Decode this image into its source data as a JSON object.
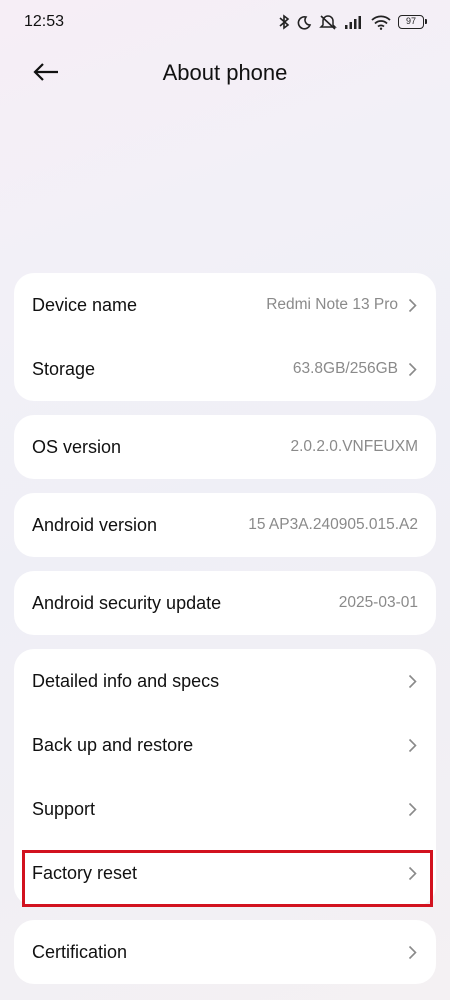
{
  "status_bar": {
    "time": "12:53",
    "battery": "97",
    "icons": [
      "bluetooth-icon",
      "moon-icon",
      "mute-icon",
      "signal-icon",
      "wifi-icon",
      "battery-icon"
    ]
  },
  "header": {
    "title": "About phone",
    "back_icon": "arrow-left-icon"
  },
  "groups": [
    {
      "rows": [
        {
          "label": "Device name",
          "value": "Redmi Note 13 Pro",
          "chevron": true
        },
        {
          "label": "Storage",
          "value": "63.8GB/256GB",
          "chevron": true
        }
      ]
    },
    {
      "rows": [
        {
          "label": "OS version",
          "value": "2.0.2.0.VNFEUXM",
          "chevron": false
        }
      ]
    },
    {
      "rows": [
        {
          "label": "Android version",
          "value": "15 AP3A.240905.015.A2",
          "chevron": false
        }
      ]
    },
    {
      "rows": [
        {
          "label": "Android security update",
          "value": "2025-03-01",
          "chevron": false
        }
      ]
    },
    {
      "rows": [
        {
          "label": "Detailed info and specs",
          "value": "",
          "chevron": true
        },
        {
          "label": "Back up and restore",
          "value": "",
          "chevron": true
        },
        {
          "label": "Support",
          "value": "",
          "chevron": true
        },
        {
          "label": "Factory reset",
          "value": "",
          "chevron": true,
          "highlighted": true
        }
      ]
    },
    {
      "rows": [
        {
          "label": "Certification",
          "value": "",
          "chevron": true
        }
      ]
    }
  ],
  "colors": {
    "highlight": "#d2121f",
    "value_text": "#8a8a8a",
    "card": "#ffffff"
  }
}
